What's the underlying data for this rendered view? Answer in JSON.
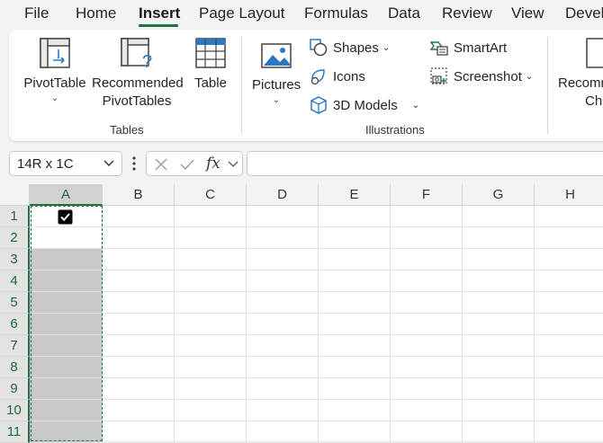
{
  "menu": {
    "items": [
      "File",
      "Home",
      "Insert",
      "Page Layout",
      "Formulas",
      "Data",
      "Review",
      "View",
      "Devel"
    ],
    "active": "Insert"
  },
  "ribbon": {
    "tables": {
      "pivot_table": "PivotTable",
      "recommended_line1": "Recommended",
      "recommended_line2": "PivotTables",
      "table": "Table",
      "group_label": "Tables"
    },
    "illustrations": {
      "pictures": "Pictures",
      "shapes": "Shapes",
      "icons": "Icons",
      "models_3d": "3D Models",
      "smartart": "SmartArt",
      "screenshot": "Screenshot",
      "group_label": "Illustrations"
    },
    "charts": {
      "recommended_line1": "Recomm",
      "recommended_line2": "Ch"
    }
  },
  "formula_bar": {
    "name_box": "14R x 1C",
    "formula": ""
  },
  "grid": {
    "columns": [
      "A",
      "B",
      "C",
      "D",
      "E",
      "F",
      "G",
      "H"
    ],
    "rows": [
      "1",
      "2",
      "3",
      "4",
      "5",
      "6",
      "7",
      "8",
      "9",
      "10",
      "11"
    ],
    "selected_column": "A",
    "cell_A1": {
      "type": "checkbox",
      "checked": true
    }
  },
  "colors": {
    "accent": "#217346",
    "selection_shade": "#c8c8c8"
  }
}
